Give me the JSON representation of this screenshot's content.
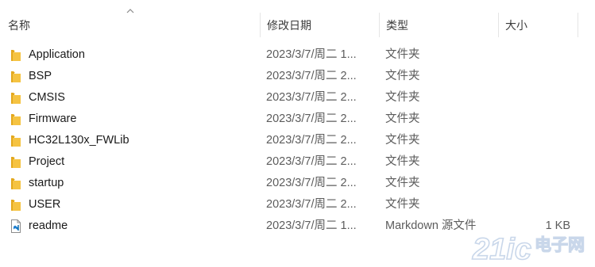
{
  "columns": {
    "name": "名称",
    "date": "修改日期",
    "type": "类型",
    "size": "大小"
  },
  "icons": {
    "sort": "chevron-up-icon",
    "folder": "folder-icon",
    "markdown": "vscode-markdown-file-icon"
  },
  "colors": {
    "folder": "#f5c342",
    "folder_dark": "#e3a81e",
    "header_text": "#3b3b3b",
    "secondary_text": "#5c5c5c",
    "watermark": "#c9d7ea"
  },
  "files": [
    {
      "name": "Application",
      "date": "2023/3/7/周二 1...",
      "type": "文件夹",
      "size": "",
      "icon": "folder"
    },
    {
      "name": "BSP",
      "date": "2023/3/7/周二 2...",
      "type": "文件夹",
      "size": "",
      "icon": "folder"
    },
    {
      "name": "CMSIS",
      "date": "2023/3/7/周二 2...",
      "type": "文件夹",
      "size": "",
      "icon": "folder"
    },
    {
      "name": "Firmware",
      "date": "2023/3/7/周二 2...",
      "type": "文件夹",
      "size": "",
      "icon": "folder"
    },
    {
      "name": "HC32L130x_FWLib",
      "date": "2023/3/7/周二 2...",
      "type": "文件夹",
      "size": "",
      "icon": "folder"
    },
    {
      "name": "Project",
      "date": "2023/3/7/周二 2...",
      "type": "文件夹",
      "size": "",
      "icon": "folder"
    },
    {
      "name": "startup",
      "date": "2023/3/7/周二 2...",
      "type": "文件夹",
      "size": "",
      "icon": "folder"
    },
    {
      "name": "USER",
      "date": "2023/3/7/周二 2...",
      "type": "文件夹",
      "size": "",
      "icon": "folder"
    },
    {
      "name": "readme",
      "date": "2023/3/7/周二 1...",
      "type": "Markdown 源文件",
      "size": "1 KB",
      "icon": "markdown"
    }
  ],
  "watermark": {
    "brand": "21ic",
    "text": "电子网"
  }
}
